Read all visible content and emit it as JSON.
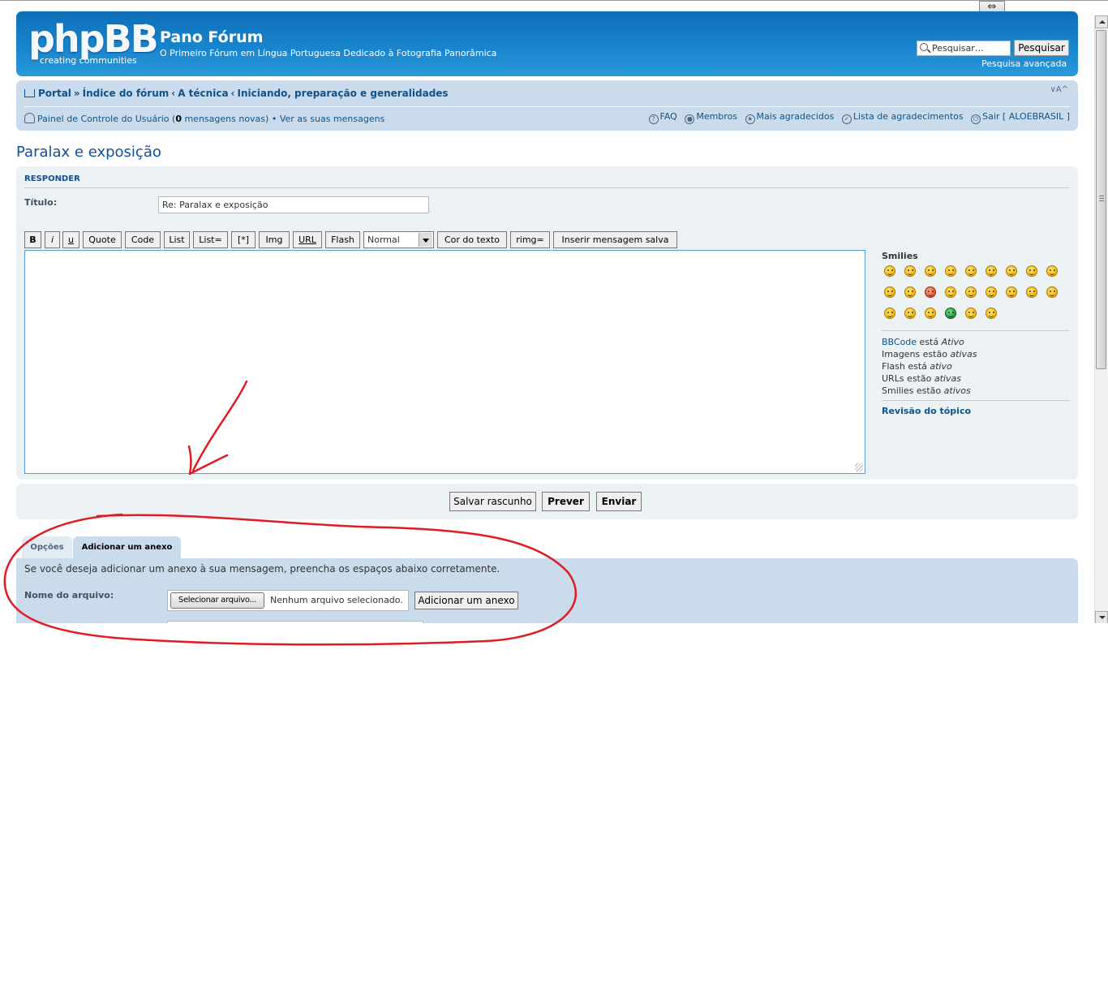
{
  "header": {
    "logo_text": "phpBB",
    "logo_reg": "®",
    "logo_tagline": "creating communities",
    "site_title": "Pano Fórum",
    "site_description": "O Primeiro Fórum em Língua Portuguesa Dedicado à Fotografia Panorâmica",
    "search_placeholder": "Pesquisar…",
    "search_button": "Pesquisar",
    "advanced_search": "Pesquisa avançada"
  },
  "navbar": {
    "breadcrumb": [
      "Portal",
      "Índice do fórum",
      "A técnica",
      "Iniciando, preparação e generalidades"
    ],
    "breadcrumb_seps": [
      "»",
      "‹",
      "‹"
    ],
    "font_size": "∨A^",
    "ucp_label": "Painel de Controle do Usuário (",
    "ucp_count": "0",
    "ucp_suffix": " mensagens novas)",
    "bullet": "•",
    "view_messages": "Ver as suas mensagens",
    "links": {
      "faq": "FAQ",
      "members": "Membros",
      "most_thanked": "Mais agradecidos",
      "thanks_list": "Lista de agradecimentos",
      "logout": "Sair [ ALOEBRASIL ]"
    }
  },
  "topic_title": "Paralax e exposição",
  "post_form": {
    "heading": "Responder",
    "title_label": "Título:",
    "title_value": "Re: Paralax e exposição",
    "bbcode_buttons": [
      "B",
      "i",
      "u",
      "Quote",
      "Code",
      "List",
      "List=",
      "[*]",
      "Img",
      "URL",
      "Flash"
    ],
    "font_size_select": "Normal",
    "color_button": "Cor do texto",
    "rimg_button": "rimg=",
    "saved_button": "Inserir mensagem salva",
    "smilies_title": "Smilies",
    "status": {
      "bbcode_link": "BBCode",
      "bbcode_text": " está ",
      "bbcode_state": "Ativo",
      "images_text": "Imagens estão ",
      "images_state": "ativas",
      "flash_text": "Flash está ",
      "flash_state": "ativo",
      "urls_text": "URLs estão ",
      "urls_state": "ativas",
      "smilies_text": "Smilies estão ",
      "smilies_state": "ativos"
    },
    "topic_review": "Revisão do tópico"
  },
  "submit": {
    "save_draft": "Salvar rascunho",
    "preview": "Prever",
    "send": "Enviar"
  },
  "tabs": {
    "options": "Opções",
    "attach": "Adicionar um anexo"
  },
  "attachments": {
    "description": "Se você deseja adicionar um anexo à sua mensagem, preencha os espaços abaixo corretamente.",
    "file_label": "Nome do arquivo:",
    "choose_button": "Selecionar arquivo...",
    "no_file": "Nenhum arquivo selecionado.",
    "add_button": "Adicionar um anexo"
  },
  "colors": {
    "header_blue": "#1a86cf",
    "nav_bg": "#cadceb",
    "panel_bg": "#ecf1f3",
    "link": "#105289",
    "annotation_red": "#e01b24"
  }
}
